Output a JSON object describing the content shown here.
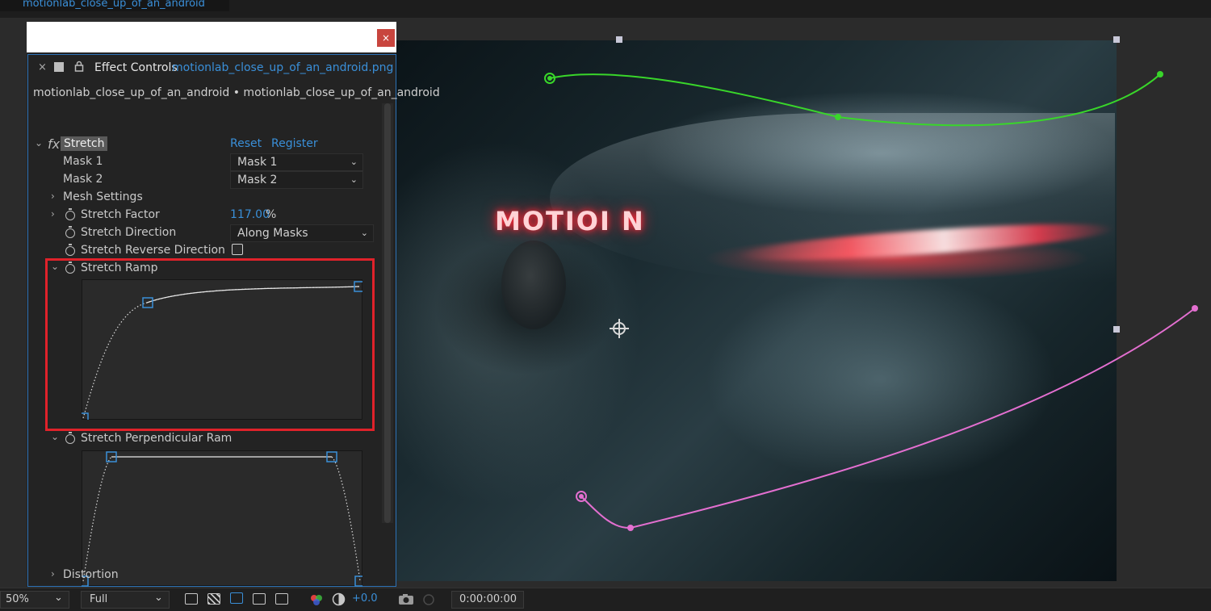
{
  "comp_tab": {
    "title": "motionlab_close_up_of_an_android"
  },
  "effect_panel": {
    "close_window_label": "×",
    "tab_close_label": "×",
    "title": "Effect Controls",
    "file": "motionlab_close_up_of_an_android.png",
    "breadcrumb": "motionlab_close_up_of_an_android • motionlab_close_up_of_an_android",
    "effect": {
      "fx_label": "fx",
      "name": "Stretch",
      "reset_label": "Reset",
      "register_label": "Register"
    },
    "properties": {
      "mask1": {
        "label": "Mask 1",
        "value": "Mask 1"
      },
      "mask2": {
        "label": "Mask 2",
        "value": "Mask 2"
      },
      "mesh_settings": {
        "label": "Mesh Settings"
      },
      "stretch_factor": {
        "label": "Stretch Factor",
        "value": "117.00",
        "unit": "%"
      },
      "stretch_direction": {
        "label": "Stretch Direction",
        "value": "Along Masks"
      },
      "stretch_reverse": {
        "label": "Stretch Reverse Direction",
        "checked": false
      },
      "stretch_ramp": {
        "label": "Stretch Ramp"
      },
      "stretch_perp_ramp": {
        "label": "Stretch Perpendicular Ram"
      },
      "distortion": {
        "label": "Distortion"
      }
    }
  },
  "viewer": {
    "overlay_text": "MOTIOI N",
    "mask_colors": {
      "mask1": "#39d62a",
      "mask2": "#e36fd0"
    }
  },
  "bottom_bar": {
    "zoom": "50%",
    "resolution": "Full",
    "exposure": "+0.0",
    "timecode": "0:00:00:00"
  },
  "icons": [
    "close-icon",
    "lock-icon",
    "stopwatch-icon",
    "chevron-down-icon",
    "chevron-right-icon",
    "anchor-point-icon",
    "camera-icon"
  ]
}
